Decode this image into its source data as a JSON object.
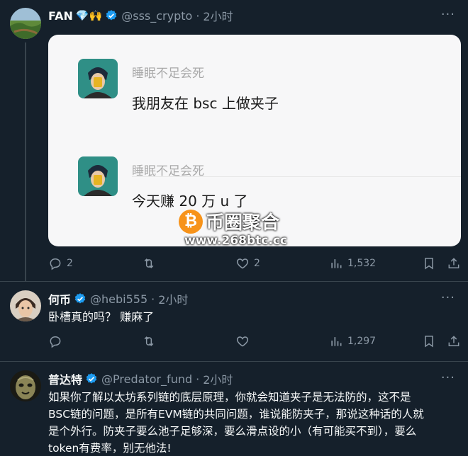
{
  "tweets": [
    {
      "name": "FAN",
      "emojis": "💎🙌",
      "handle": "@sss_crypto",
      "time": "2小时",
      "replies": "2",
      "likes": "2",
      "views": "1,532"
    },
    {
      "name": "何币",
      "handle": "@hebi555",
      "time": "2小时",
      "text": "卧槽真的吗？ 赚麻了",
      "views": "1,297"
    },
    {
      "name": "普达特",
      "handle": "@Predator_fund",
      "time": "2小时",
      "text_lines": [
        "如果你了解以太坊系列链的底层原理，你就会知道夹子是无法防的，这不是",
        "BSC链的问题，是所有EVM链的共同问题，谁说能防夹子，那说这种话的人就",
        "是个外行。防夹子要么池子足够深，要么滑点设的小（有可能买不到），要么",
        "token有费率，别无他法!"
      ]
    }
  ],
  "embed": {
    "messages": [
      {
        "sender": "睡眠不足会死",
        "text": "我朋友在 bsc 上做夹子"
      },
      {
        "sender": "睡眠不足会死",
        "text": "今天赚 20 万 u 了"
      }
    ]
  },
  "watermark": {
    "coin": "₿",
    "title": "币圈聚合",
    "url": "www.268btc.cc"
  },
  "separator": "·",
  "more_glyph": "···",
  "colors": {
    "bg": "#15202b",
    "muted": "#8b98a5",
    "verified": "#1d9bf0",
    "divider": "#38444d"
  }
}
